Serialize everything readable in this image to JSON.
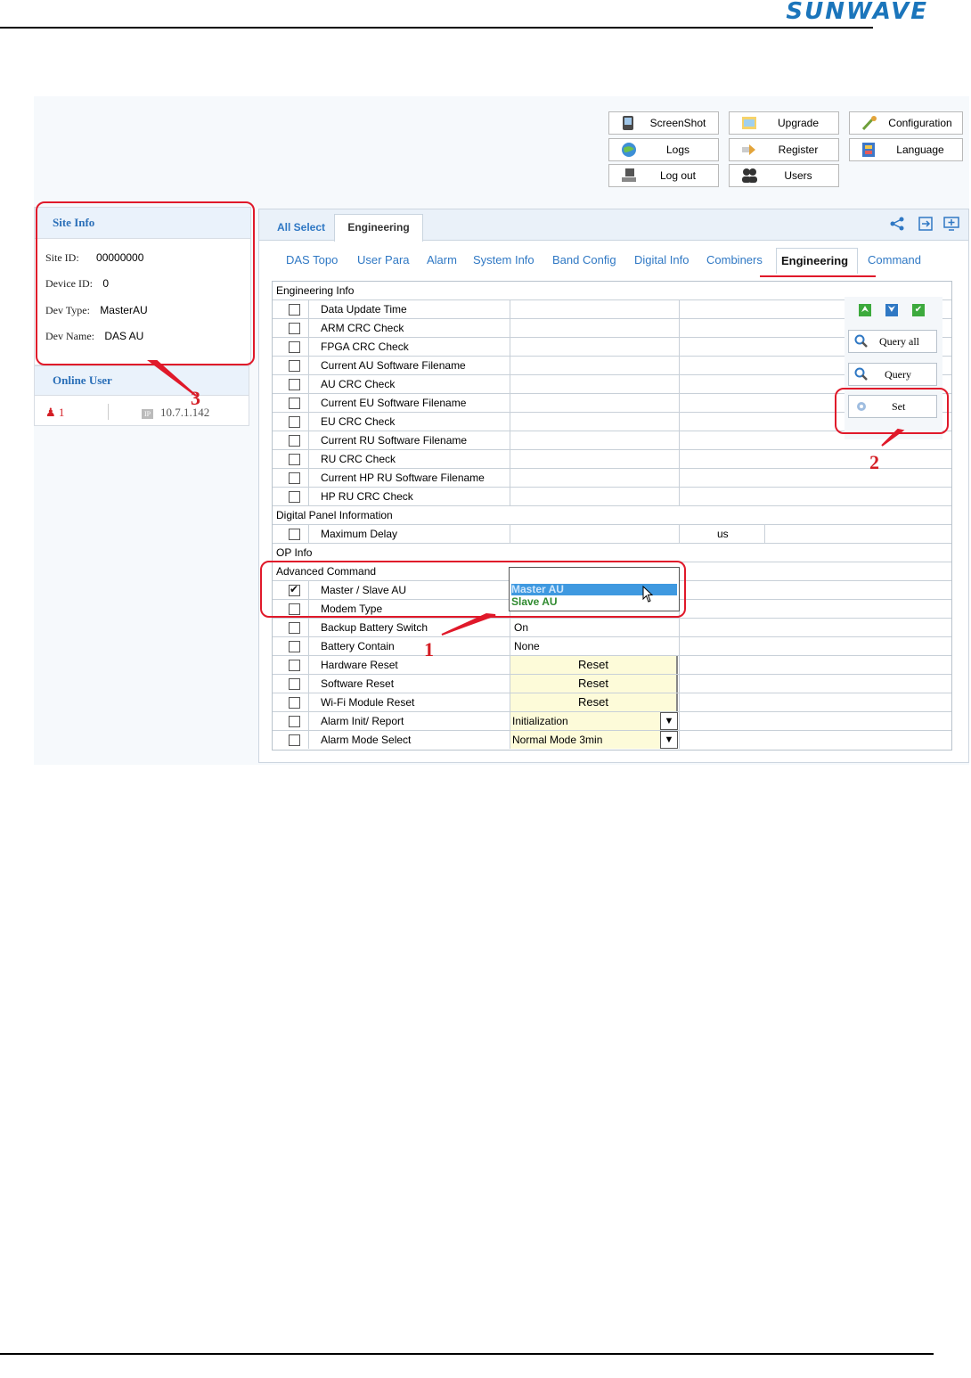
{
  "header": {
    "brand": "SUNWAVE"
  },
  "toolbar": {
    "screenshot": "ScreenShot",
    "upgrade": "Upgrade",
    "configuration": "Configuration",
    "logs": "Logs",
    "register": "Register",
    "language": "Language",
    "logout": "Log out",
    "users": "Users"
  },
  "site_info": {
    "title": "Site Info",
    "site_id_label": "Site ID:",
    "site_id": "00000000",
    "device_id_label": "Device ID:",
    "device_id": "0",
    "dev_type_label": "Dev Type:",
    "dev_type": "MasterAU",
    "dev_name_label": "Dev Name:",
    "dev_name": "DAS AU"
  },
  "online_user": {
    "title": "Online User",
    "count": "1",
    "ip": "10.7.1.142"
  },
  "tabs": {
    "all_select": "All Select",
    "engineering": "Engineering"
  },
  "subtabs": [
    "DAS Topo",
    "User Para",
    "Alarm",
    "System Info",
    "Band Config",
    "Digital Info",
    "Combiners",
    "Engineering",
    "Command"
  ],
  "side_actions": {
    "query_all": "Query all",
    "query": "Query",
    "set": "Set"
  },
  "table": {
    "engineering_info": {
      "title": "Engineering Info",
      "rows": [
        "Data Update Time",
        "ARM CRC Check",
        "FPGA CRC Check",
        "Current AU Software Filename",
        "AU CRC Check",
        "Current EU Software Filename",
        "EU CRC Check",
        "Current RU Software Filename",
        "RU CRC Check",
        "Current HP RU Software Filename",
        "HP RU CRC Check"
      ]
    },
    "digital_panel": {
      "title": "Digital Panel Information",
      "row": "Maximum Delay",
      "unit": "us"
    },
    "op_info": {
      "title": "OP Info"
    },
    "advanced": {
      "title": "Advanced Command",
      "master_slave": "Master / Slave AU",
      "modem_type": "Modem Type",
      "backup_battery": "Backup Battery Switch",
      "backup_battery_value": "On",
      "battery_contain": "Battery Contain",
      "battery_contain_value": "None",
      "hardware_reset": "Hardware Reset",
      "software_reset": "Software Reset",
      "wifi_reset": "Wi-Fi Module Reset",
      "reset_label": "Reset",
      "alarm_init": "Alarm Init/ Report",
      "alarm_init_value": "Initialization",
      "alarm_mode": "Alarm Mode Select",
      "alarm_mode_value": "Normal Mode 3min"
    }
  },
  "dropdown": {
    "options": [
      "Master AU",
      "Slave AU"
    ]
  },
  "callouts": {
    "one": "1",
    "two": "2",
    "three": "3"
  },
  "colors": {
    "accent": "#2f78c4",
    "annotation": "#e0192a",
    "dropdown_highlight": "#3f99e0"
  }
}
